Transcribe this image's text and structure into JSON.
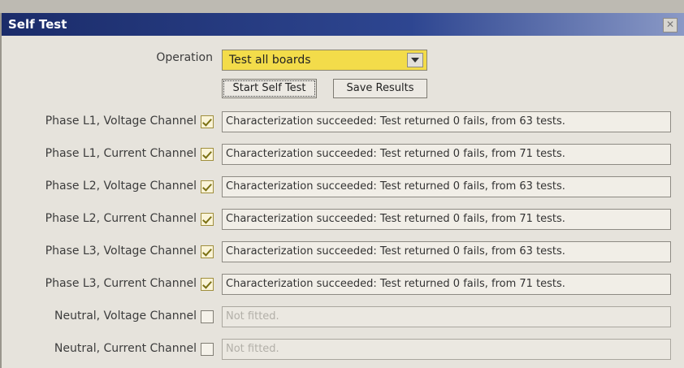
{
  "window": {
    "title": "Self Test"
  },
  "operation": {
    "label": "Operation",
    "selected": "Test all boards",
    "highlight_color": "#f3dc4a"
  },
  "buttons": {
    "start": "Start Self Test",
    "save": "Save Results"
  },
  "channels": [
    {
      "label": "Phase L1, Voltage Channel",
      "checked": true,
      "result": "Characterization succeeded: Test returned 0 fails, from 63 tests.",
      "enabled": true
    },
    {
      "label": "Phase L1, Current Channel",
      "checked": true,
      "result": "Characterization succeeded: Test returned 0 fails, from 71 tests.",
      "enabled": true
    },
    {
      "label": "Phase L2, Voltage Channel",
      "checked": true,
      "result": "Characterization succeeded: Test returned 0 fails, from 63 tests.",
      "enabled": true
    },
    {
      "label": "Phase L2, Current Channel",
      "checked": true,
      "result": "Characterization succeeded: Test returned 0 fails, from 71 tests.",
      "enabled": true
    },
    {
      "label": "Phase L3, Voltage Channel",
      "checked": true,
      "result": "Characterization succeeded: Test returned 0 fails, from 63 tests.",
      "enabled": true
    },
    {
      "label": "Phase L3, Current Channel",
      "checked": true,
      "result": "Characterization succeeded: Test returned 0 fails, from 71 tests.",
      "enabled": true
    },
    {
      "label": "Neutral, Voltage Channel",
      "checked": false,
      "result": "Not fitted.",
      "enabled": false
    },
    {
      "label": "Neutral, Current Channel",
      "checked": false,
      "result": "Not fitted.",
      "enabled": false
    }
  ]
}
